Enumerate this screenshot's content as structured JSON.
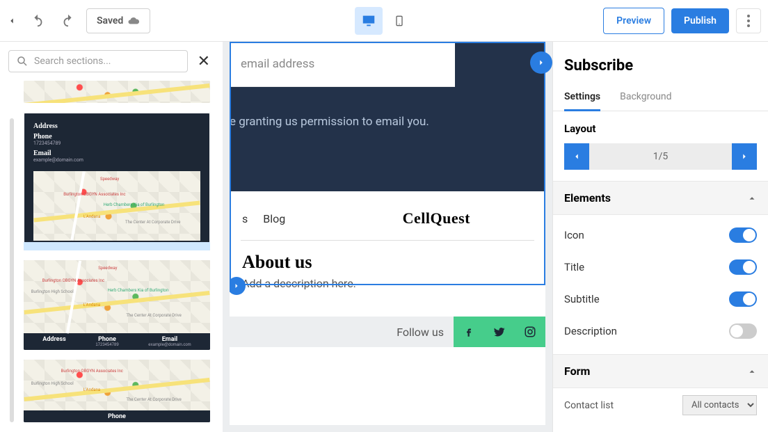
{
  "topbar": {
    "saved_label": "Saved",
    "preview_label": "Preview",
    "publish_label": "Publish"
  },
  "search": {
    "placeholder": "Search sections..."
  },
  "thumbs": {
    "t2": {
      "address_label": "Address",
      "phone_label": "Phone",
      "phone_value": "1723454789",
      "email_label": "Email",
      "email_value": "example@domain.com"
    },
    "t3": {
      "address_label": "Address",
      "phone_label": "Phone",
      "phone_value": "1723454789",
      "email_label": "Email",
      "email_value": "example@domain.com"
    },
    "t4": {
      "phone_label": "Phone"
    },
    "map_labels": {
      "l1": "Speedway",
      "l2": "Burlington OBGYN Associates Inc",
      "l3": "Burlington High School",
      "l4": "Herb Chambers Kia of Burlington",
      "l5": "L'Andana",
      "l6": "The Center At Corporate Drive"
    }
  },
  "canvas": {
    "email_placeholder": "email address",
    "permission_text": "e granting us permission to email you.",
    "nav": {
      "item1": "s",
      "item2": "Blog",
      "brand": "CellQuest"
    },
    "about": {
      "heading": "About us",
      "desc": "Add a description here."
    },
    "follow_label": "Follow us"
  },
  "props": {
    "title": "Subscribe",
    "tabs": {
      "settings": "Settings",
      "background": "Background"
    },
    "layout_label": "Layout",
    "layout_value": "1/5",
    "elements_label": "Elements",
    "elem_icon": "Icon",
    "elem_title": "Title",
    "elem_subtitle": "Subtitle",
    "elem_description": "Description",
    "form_label": "Form",
    "contact_list_label": "Contact list",
    "contact_list_value": "All contacts"
  }
}
